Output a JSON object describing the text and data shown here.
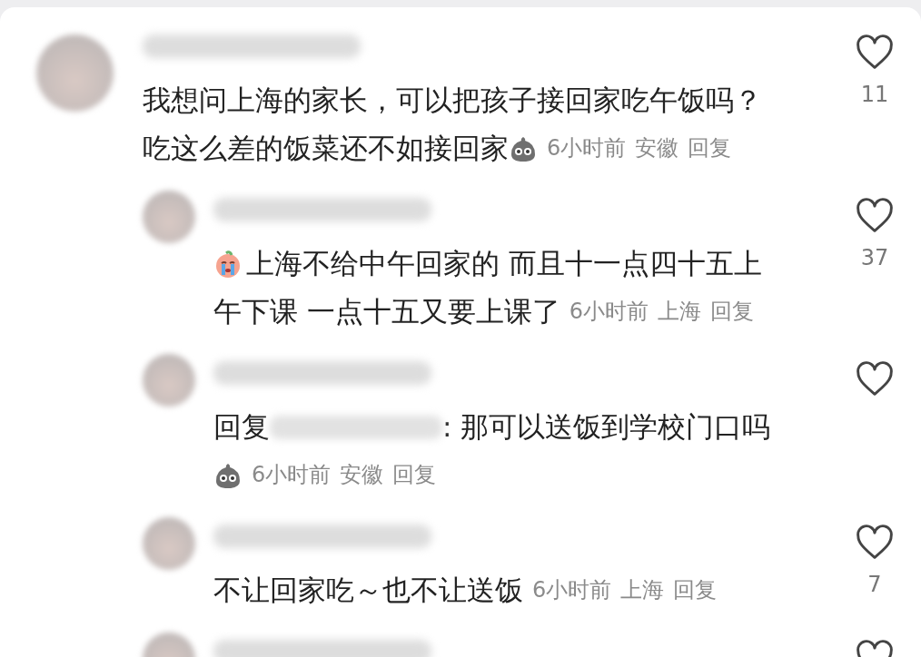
{
  "comments": [
    {
      "kind": "top",
      "likes": "11",
      "lines": [
        [
          {
            "kind": "text",
            "text": "我想问上海的家长，可以把孩子接回家吃午饭吗？"
          }
        ],
        [
          {
            "kind": "text",
            "text": "吃这么差的饭菜还不如接回家"
          },
          {
            "kind": "blob_sticker"
          },
          {
            "kind": "time",
            "text": "6小时前"
          },
          {
            "kind": "location",
            "text": "安徽"
          },
          {
            "kind": "action",
            "text": "回复"
          }
        ]
      ]
    },
    {
      "kind": "reply",
      "likes": "37",
      "lines": [
        [
          {
            "kind": "crying_sticker"
          },
          {
            "kind": "text",
            "text": "上海不给中午回家的 而且十一点四十五上"
          }
        ],
        [
          {
            "kind": "text",
            "text": "午下课 一点十五又要上课了"
          },
          {
            "kind": "time",
            "text": "6小时前"
          },
          {
            "kind": "location",
            "text": "上海"
          },
          {
            "kind": "action",
            "text": "回复"
          }
        ]
      ]
    },
    {
      "kind": "reply",
      "lines": [
        [
          {
            "kind": "text",
            "text": "回复"
          },
          {
            "kind": "mention"
          },
          {
            "kind": "text",
            "text": ": 那可以送饭到学校门口吗"
          }
        ],
        [
          {
            "kind": "blob_sticker"
          },
          {
            "kind": "time",
            "text": "6小时前"
          },
          {
            "kind": "location",
            "text": "安徽"
          },
          {
            "kind": "action",
            "text": "回复"
          }
        ]
      ]
    },
    {
      "kind": "reply",
      "likes": "7",
      "lines": [
        [
          {
            "kind": "text",
            "text": "不让回家吃～也不让送饭"
          },
          {
            "kind": "time",
            "text": "6小时前"
          },
          {
            "kind": "location",
            "text": "上海"
          },
          {
            "kind": "action",
            "text": "回复"
          }
        ]
      ]
    },
    {
      "kind": "reply"
    }
  ]
}
